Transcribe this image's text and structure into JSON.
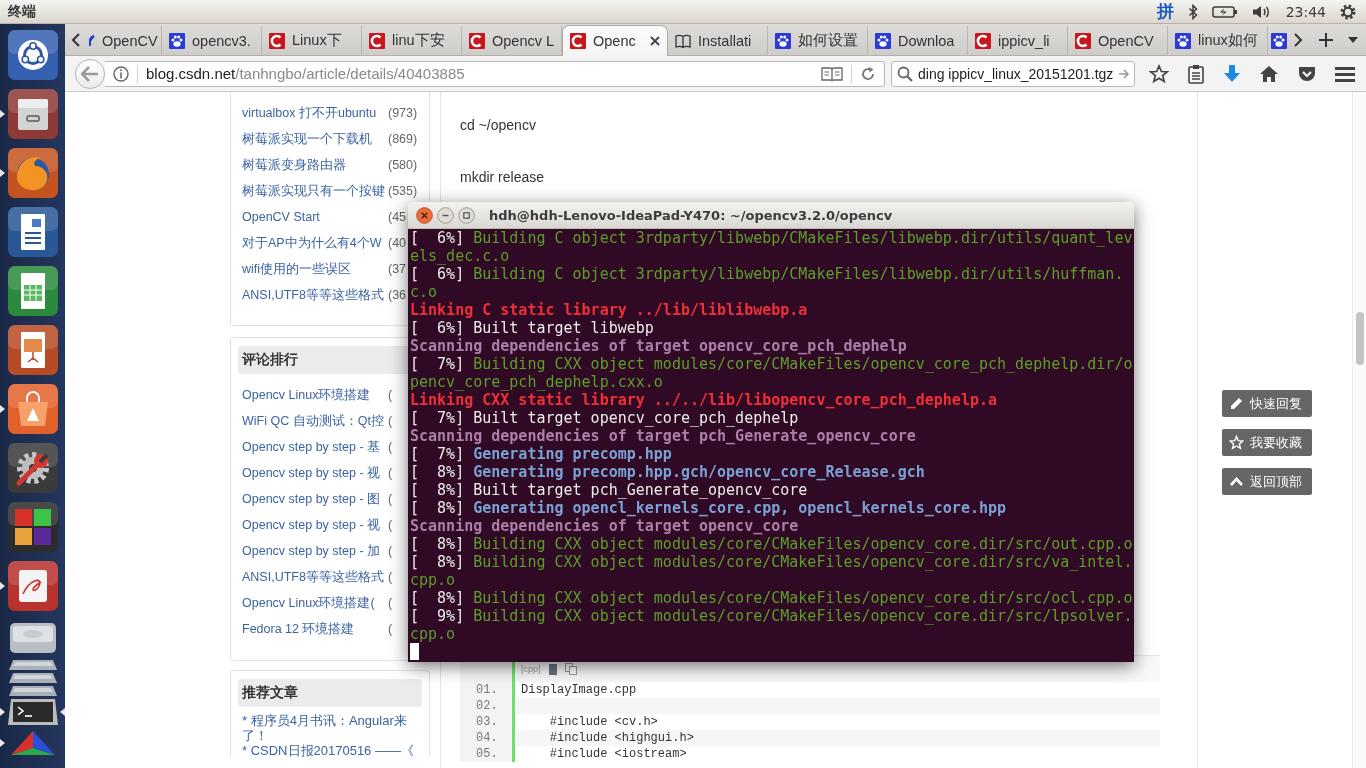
{
  "top_panel": {
    "app_title": "终端",
    "input_method": "拼",
    "clock": "23:44"
  },
  "launcher": [
    {
      "kind": "dash",
      "running": false,
      "focused": false
    },
    {
      "kind": "files",
      "running": true,
      "focused": false
    },
    {
      "kind": "browser",
      "running": true,
      "focused": false
    },
    {
      "kind": "writer",
      "running": false,
      "focused": false
    },
    {
      "kind": "calc",
      "running": false,
      "focused": false
    },
    {
      "kind": "impress",
      "running": false,
      "focused": false
    },
    {
      "kind": "software",
      "running": true,
      "focused": false
    },
    {
      "kind": "settings",
      "running": false,
      "focused": false
    },
    {
      "kind": "blocks",
      "running": false,
      "focused": false
    },
    {
      "kind": "viewer",
      "running": true,
      "focused": false
    },
    {
      "kind": "drive",
      "running": false,
      "focused": false
    },
    {
      "kind": "drive-folded",
      "running": false,
      "focused": false
    },
    {
      "kind": "drive-folded",
      "running": false,
      "focused": false
    },
    {
      "kind": "drive-folded",
      "running": false,
      "focused": false
    },
    {
      "kind": "terminal",
      "running": true,
      "focused": true
    },
    {
      "kind": "triangle",
      "running": true,
      "focused": false
    }
  ],
  "browser": {
    "tabs": [
      {
        "kind": "partial",
        "title": "OpenCV",
        "selected": false
      },
      {
        "kind": "paw",
        "title": "opencv3.",
        "selected": false
      },
      {
        "kind": "c",
        "title": "Linux下",
        "selected": false
      },
      {
        "kind": "c",
        "title": "linu下安",
        "selected": false
      },
      {
        "kind": "c",
        "title": "Opencv L",
        "selected": false
      },
      {
        "kind": "c",
        "title": "Openc",
        "selected": true
      },
      {
        "kind": "book",
        "title": "Installati",
        "selected": false
      },
      {
        "kind": "paw",
        "title": "如何设置",
        "selected": false
      },
      {
        "kind": "paw",
        "title": "Downloa",
        "selected": false
      },
      {
        "kind": "c",
        "title": "ippicv_li",
        "selected": false
      },
      {
        "kind": "c",
        "title": "OpenCV",
        "selected": false
      },
      {
        "kind": "paw",
        "title": "linux如何",
        "selected": false
      },
      {
        "kind": "paw",
        "selected": false
      }
    ],
    "url_host": "blog.csdn.net",
    "url_path": "/tanhngbo/article/details/40403885",
    "search": "ding ippicv_linux_20151201.tgz"
  },
  "sidebar": [
    {
      "items": [
        {
          "title": "virtualbox 打不开ubuntu",
          "count": "(973)"
        },
        {
          "title": "树莓派实现一个下载机",
          "count": "(869)"
        },
        {
          "title": "树莓派变身路由器",
          "count": "(580)"
        },
        {
          "title": "树莓派实现只有一个按键",
          "count": "(535)"
        },
        {
          "title": "OpenCV Start",
          "count": "(45"
        },
        {
          "title": "对于AP中为什么有4个W",
          "count": "(40"
        },
        {
          "title": "wifi使用的一些误区",
          "count": "(37"
        },
        {
          "title": "ANSI,UTF8等等这些格式",
          "count": "(36"
        }
      ]
    },
    {
      "heading": "评论排行",
      "items": [
        {
          "title": "Opencv Linux环境搭建",
          "count": "("
        },
        {
          "title": "WiFi QC 自动测试：Qt控",
          "count": "("
        },
        {
          "title": "Opencv step by step - 基",
          "count": "("
        },
        {
          "title": "Opencv step by step - 视",
          "count": "("
        },
        {
          "title": "Opencv step by step - 图",
          "count": "("
        },
        {
          "title": "Opencv step by step - 视",
          "count": "("
        },
        {
          "title": "Opencv step by step - 加",
          "count": "("
        },
        {
          "title": "ANSI,UTF8等等这些格式",
          "count": "("
        },
        {
          "title": "Opencv Linux环境搭建(",
          "count": "("
        },
        {
          "title": "Fedora 12 环境搭建",
          "count": "("
        }
      ]
    },
    {
      "heading": "推荐文章",
      "items": [
        {
          "title": "* 程序员4月书讯：Angular来了！"
        },
        {
          "title": "* CSDN日报20170516 ——《"
        }
      ]
    }
  ],
  "article": {
    "paragraphs": [
      "cd ~/opencv",
      "mkdir release"
    ],
    "code": {
      "label": "[cpp]",
      "lines": [
        {
          "number": "01.",
          "text": "DisplayImage.cpp"
        },
        {
          "number": "02."
        },
        {
          "number": "03.",
          "text": "    #include <cv.h>"
        },
        {
          "number": "04.",
          "text": "    #include <highgui.h>"
        },
        {
          "number": "05.",
          "text": "    #include <iostream>"
        }
      ]
    }
  },
  "side_buttons": [
    {
      "kind": "pencil",
      "label": "快速回复"
    },
    {
      "kind": "star",
      "label": "我要收藏"
    },
    {
      "kind": "chevron",
      "label": "返回顶部"
    }
  ],
  "terminal": {
    "title": "hdh@hdh-Lenovo-IdeaPad-Y470: ~/opencv3.2.0/opencv",
    "lines": [
      {
        "kind": "build",
        "progress": "[  6%]",
        "text": "Building C object 3rdparty/libwebp/CMakeFiles/libwebp.dir/utils/quant_levels_dec.c.o"
      },
      {
        "kind": "build",
        "progress": "[  6%]",
        "text": "Building C object 3rdparty/libwebp/CMakeFiles/libwebp.dir/utils/huffman.c.o"
      },
      {
        "kind": "link",
        "text": "Linking C static library ../lib/liblibwebp.a"
      },
      {
        "kind": "built",
        "progress": "[  6%]",
        "text": "Built target libwebp"
      },
      {
        "kind": "scan",
        "text": "Scanning dependencies of target opencv_core_pch_dephelp"
      },
      {
        "kind": "build",
        "progress": "[  7%]",
        "text": "Building CXX object modules/core/CMakeFiles/opencv_core_pch_dephelp.dir/opencv_core_pch_dephelp.cxx.o"
      },
      {
        "kind": "link",
        "text": "Linking CXX static library ../../lib/libopencv_core_pch_dephelp.a"
      },
      {
        "kind": "built",
        "progress": "[  7%]",
        "text": "Built target opencv_core_pch_dephelp"
      },
      {
        "kind": "scan",
        "text": "Scanning dependencies of target pch_Generate_opencv_core"
      },
      {
        "kind": "generate",
        "progress": "[  7%]",
        "text": "Generating precomp.hpp"
      },
      {
        "kind": "generate",
        "progress": "[  8%]",
        "text": "Generating precomp.hpp.gch/opencv_core_Release.gch"
      },
      {
        "kind": "built",
        "progress": "[  8%]",
        "text": "Built target pch_Generate_opencv_core"
      },
      {
        "kind": "generate",
        "progress": "[  8%]",
        "text": "Generating opencl_kernels_core.cpp, opencl_kernels_core.hpp"
      },
      {
        "kind": "scan",
        "text": "Scanning dependencies of target opencv_core"
      },
      {
        "kind": "build",
        "progress": "[  8%]",
        "text": "Building CXX object modules/core/CMakeFiles/opencv_core.dir/src/out.cpp.o"
      },
      {
        "kind": "build",
        "progress": "[  8%]",
        "text": "Building CXX object modules/core/CMakeFiles/opencv_core.dir/src/va_intel.cpp.o"
      },
      {
        "kind": "build",
        "progress": "[  8%]",
        "text": "Building CXX object modules/core/CMakeFiles/opencv_core.dir/src/ocl.cpp.o"
      },
      {
        "kind": "build",
        "progress": "[  9%]",
        "text": "Building CXX object modules/core/CMakeFiles/opencv_core.dir/src/lpsolver.cpp.o"
      }
    ]
  }
}
